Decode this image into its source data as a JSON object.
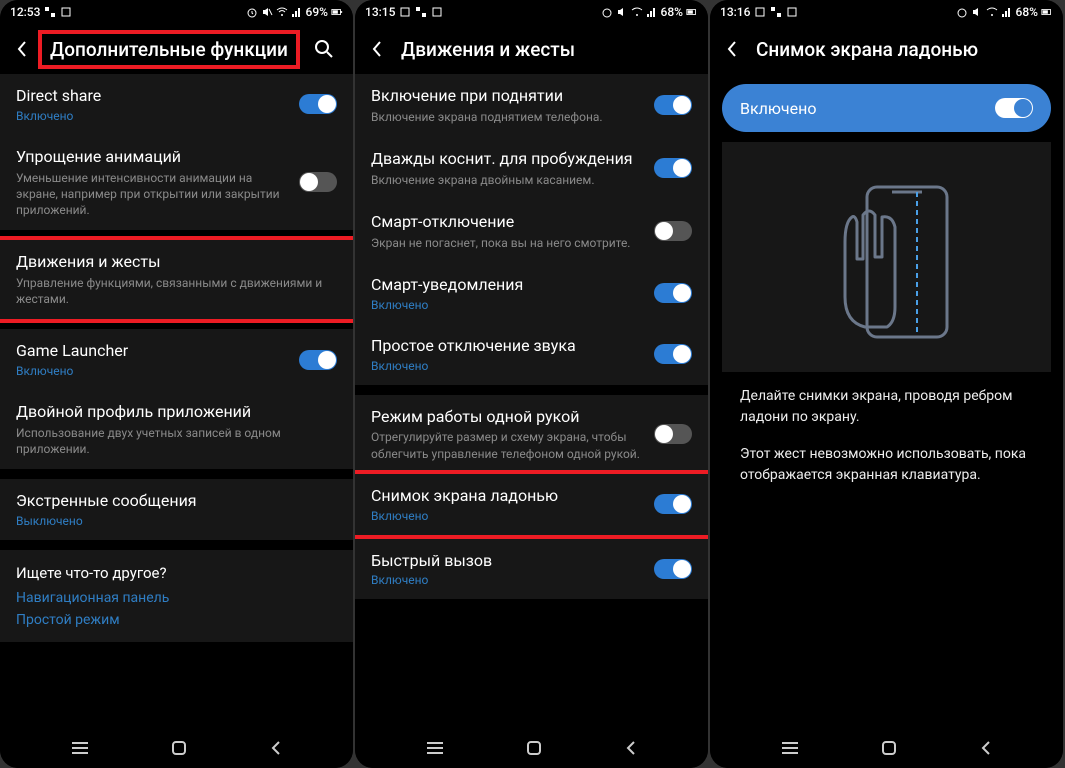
{
  "phone1": {
    "status": {
      "time": "12:53",
      "battery": "69%"
    },
    "header": "Дополнительные функции",
    "items": [
      {
        "title": "Direct share",
        "status": "Включено",
        "statusClass": "item-status-on",
        "toggle": "on"
      },
      {
        "title": "Упрощение анимаций",
        "sub": "Уменьшение интенсивности анимации на экране, например при открытии или закрытии приложений.",
        "toggle": "off"
      },
      {
        "title": "Движения и жесты",
        "sub": "Управление функциями, связанными с движениями и жестами."
      },
      {
        "title": "Game Launcher",
        "status": "Включено",
        "statusClass": "item-status-on",
        "toggle": "on"
      },
      {
        "title": "Двойной профиль приложений",
        "sub": "Использование двух учетных записей в одном приложении."
      },
      {
        "title": "Экстренные сообщения",
        "status": "Выключено",
        "statusClass": "item-status-on"
      }
    ],
    "hint": {
      "title": "Ищете что-то другое?",
      "link1": "Навигационная панель",
      "link2": "Простой режим"
    }
  },
  "phone2": {
    "status": {
      "time": "13:15",
      "battery": "68%"
    },
    "header": "Движения и жесты",
    "items": [
      {
        "title": "Включение при поднятии",
        "sub": "Включение экрана поднятием телефона.",
        "toggle": "on"
      },
      {
        "title": "Дважды коснит. для пробуждения",
        "sub": "Включение экрана двойным касанием.",
        "toggle": "on"
      },
      {
        "title": "Смарт-отключение",
        "sub": "Экран не погаснет, пока вы на него смотрите.",
        "toggle": "off"
      },
      {
        "title": "Смарт-уведомления",
        "status": "Включено",
        "statusClass": "item-status-on",
        "toggle": "on"
      },
      {
        "title": "Простое отключение звука",
        "status": "Включено",
        "statusClass": "item-status-on",
        "toggle": "on"
      },
      {
        "title": "Режим работы одной рукой",
        "sub": "Отрегулируйте размер и схему экрана, чтобы облегчить управление телефоном одной рукой.",
        "toggle": "off"
      },
      {
        "title": "Снимок экрана ладонью",
        "status": "Включено",
        "statusClass": "item-status-on",
        "toggle": "on"
      },
      {
        "title": "Быстрый вызов",
        "status": "Включено",
        "statusClass": "item-status-on",
        "toggle": "on"
      }
    ]
  },
  "phone3": {
    "status": {
      "time": "13:16",
      "battery": "68%"
    },
    "header": "Снимок экрана ладонью",
    "enabled": "Включено",
    "desc1": "Делайте снимки экрана, проводя ребром ладони по экрану.",
    "desc2": "Этот жест невозможно использовать, пока отображается экранная клавиатура."
  }
}
